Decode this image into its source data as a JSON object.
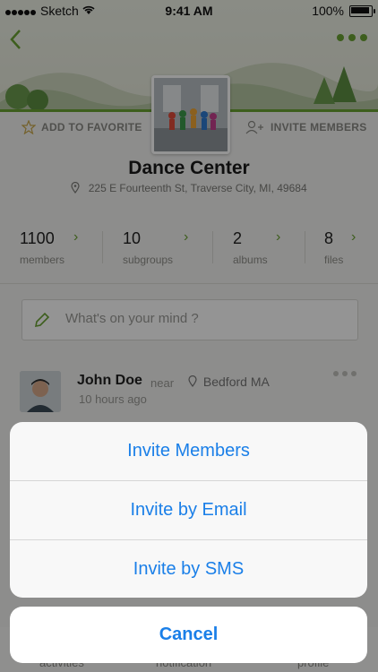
{
  "status_bar": {
    "carrier": "Sketch",
    "time": "9:41 AM",
    "battery": "100%"
  },
  "group": {
    "name": "Dance Center",
    "address": "225 E Fourteenth St, Traverse City, MI, 49684",
    "add_favorite_label": "ADD TO FAVORITE",
    "invite_members_label": "INVITE MEMBERS"
  },
  "stats": [
    {
      "value": "1100",
      "label": "members"
    },
    {
      "value": "10",
      "label": "subgroups"
    },
    {
      "value": "2",
      "label": "albums"
    },
    {
      "value": "8",
      "label": "files"
    }
  ],
  "composer": {
    "placeholder": "What's on your mind ?"
  },
  "post": {
    "author": "John Doe",
    "near_label": "near",
    "place": "Bedford MA",
    "time": "10 hours ago"
  },
  "tabbar": {
    "tabs": [
      "activities",
      "notification",
      "profile"
    ]
  },
  "action_sheet": {
    "options": [
      "Invite Members",
      "Invite by Email",
      "Invite by SMS"
    ],
    "cancel_label": "Cancel"
  },
  "colors": {
    "accent": "#6aa232",
    "ios_blue": "#1a7fe8"
  }
}
